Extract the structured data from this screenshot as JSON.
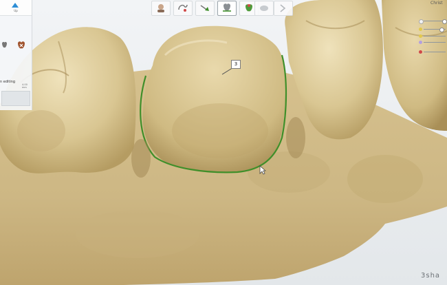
{
  "app": {
    "brand_text": "3sha",
    "right_panel_title": "Christ"
  },
  "left_panel": {
    "top_label": "Up",
    "edit_label": "n editing",
    "small_value": "4.00 mm"
  },
  "toolbar": {
    "tools": [
      {
        "icon": "patient-icon"
      },
      {
        "icon": "margin-line-icon"
      },
      {
        "icon": "insertion-direction-icon"
      },
      {
        "icon": "preparation-icon",
        "active": true
      },
      {
        "icon": "crown-icon"
      },
      {
        "icon": "scan-icon"
      },
      {
        "icon": "next-arrow-icon"
      }
    ]
  },
  "right_panel": {
    "rows": [
      {
        "color": "#f2f2f2"
      },
      {
        "color": "#e2c94c"
      },
      {
        "color": "#e2c94c"
      },
      {
        "color": "#b3a0e0"
      },
      {
        "color": "#d04848"
      }
    ]
  },
  "viewport": {
    "tooth_number": "3",
    "margin_line_color": "#3f8f2a",
    "model_color": "#d9c89a"
  }
}
